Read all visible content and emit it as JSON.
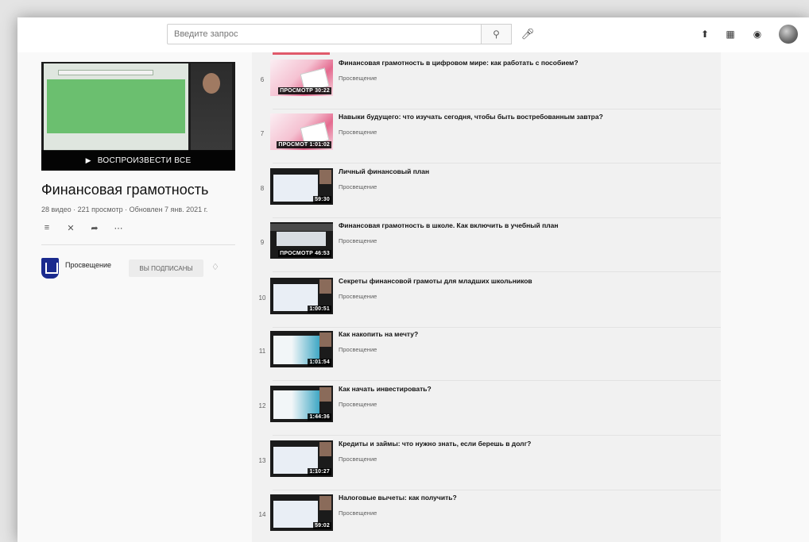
{
  "header": {
    "search_placeholder": "Введите запрос",
    "icons": [
      "search-icon",
      "mic-icon",
      "upload-icon",
      "apps-grid-icon",
      "bell-icon",
      "avatar"
    ]
  },
  "playlist": {
    "play_all_label": "ВОСПРОИЗВЕСТИ ВСЕ",
    "title": "Финансовая грамотность",
    "meta": "28 видео · 221 просмотр · Обновлен 7 янв. 2021 г.",
    "owner": {
      "name": "Просвещение",
      "subscribed_label": "ВЫ ПОДПИСАНЫ"
    }
  },
  "videos": [
    {
      "index": "6",
      "title": "Финансовая грамотность в цифровом мире: как работать с пособием?",
      "channel": "Просвещение",
      "duration": "ПРОСМОТР 30:22",
      "thumb": "pink"
    },
    {
      "index": "7",
      "title": "Навыки будущего: что изучать сегодня, чтобы быть востребованным завтра?",
      "channel": "Просвещение",
      "duration": "ПРОСМОТ 1:01:02",
      "thumb": "pink"
    },
    {
      "index": "8",
      "title": "Личный финансовый план",
      "channel": "Просвещение",
      "duration": "59:30",
      "thumb": "dark"
    },
    {
      "index": "9",
      "title": "Финансовая грамотность в школе. Как включить в учебный план",
      "channel": "Просвещение",
      "duration": "ПРОСМОТР 46:53",
      "thumb": "header"
    },
    {
      "index": "10",
      "title": "Секреты финансовой грамоты для младших школьников",
      "channel": "Просвещение",
      "duration": "1:00:51",
      "thumb": "dark"
    },
    {
      "index": "11",
      "title": "Как накопить на мечту?",
      "channel": "Просвещение",
      "duration": "1:01:54",
      "thumb": "tealt"
    },
    {
      "index": "12",
      "title": "Как начать инвестировать?",
      "channel": "Просвещение",
      "duration": "1:44:36",
      "thumb": "tealt"
    },
    {
      "index": "13",
      "title": "Кредиты и займы: что нужно знать, если берешь в долг?",
      "channel": "Просвещение",
      "duration": "1:10:27",
      "thumb": "dark"
    },
    {
      "index": "14",
      "title": "Налоговые вычеты: как получить?",
      "channel": "Просвещение",
      "duration": "59:02",
      "thumb": "dark"
    }
  ]
}
